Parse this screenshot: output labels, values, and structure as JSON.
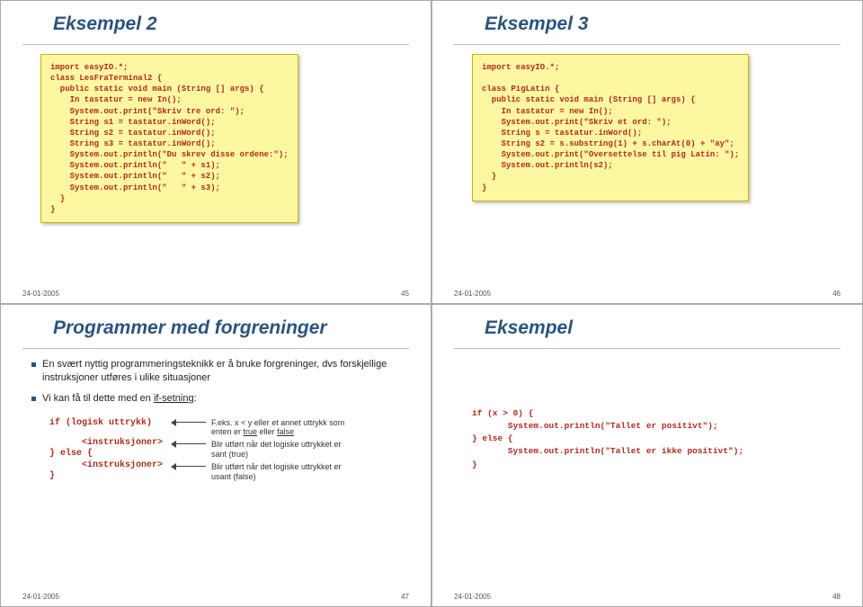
{
  "slides": [
    {
      "title": "Eksempel 2",
      "code": "import easyIO.*;\nclass LesFraTerminal2 {\n  public static void main (String [] args) {\n    In tastatur = new In();\n    System.out.print(\"Skriv tre ord: \");\n    String s1 = tastatur.inWord();\n    String s2 = tastatur.inWord();\n    String s3 = tastatur.inWord();\n    System.out.println(\"Du skrev disse ordene:\");\n    System.out.println(\"   \" + s1);\n    System.out.println(\"   \" + s2);\n    System.out.println(\"   \" + s3);\n  }\n}",
      "date": "24-01-2005",
      "page": "45"
    },
    {
      "title": "Eksempel 3",
      "code": "import easyIO.*;\n\nclass PigLatin {\n  public static void main (String [] args) {\n    In tastatur = new In();\n    System.out.print(\"Skriv et ord: \");\n    String s = tastatur.inWord();\n    String s2 = s.substring(1) + s.charAt(0) + \"ay\";\n    System.out.print(\"Oversettelse til pig Latin: \");\n    System.out.println(s2);\n  }\n}",
      "date": "24-01-2005",
      "page": "46"
    },
    {
      "title": "Programmer med forgreninger",
      "bullet1": "En svært nyttig programmeringsteknikk er å bruke forgreninger, dvs forskjellige instruksjoner utføres i ulike situasjoner",
      "bullet2_pre": "Vi kan få til dette med en ",
      "bullet2_u": "if-setning",
      "bullet2_post": ":",
      "rows": [
        {
          "code": "if (logisk uttrykk)",
          "note_pre": "F.eks. x < y eller et annet uttrykk som enten er ",
          "u1": "true",
          "mid": " eller ",
          "u2": "false"
        },
        {
          "code": "      <instruksjoner>",
          "note": ""
        },
        {
          "code": "} else {",
          "note": "Blir utført når det logiske uttrykket er sant (true)"
        },
        {
          "code": "      <instruksjoner>",
          "note": ""
        },
        {
          "code": "}",
          "note": "Blir utført når det logiske uttrykket er usant (false)"
        }
      ],
      "date": "24-01-2005",
      "page": "47"
    },
    {
      "title": "Eksempel",
      "code": "if (x > 0) {\n       System.out.println(\"Tallet er positivt\");\n} else {\n       System.out.println(\"Tallet er ikke positivt\");\n}",
      "date": "24-01-2005",
      "page": "48"
    }
  ]
}
